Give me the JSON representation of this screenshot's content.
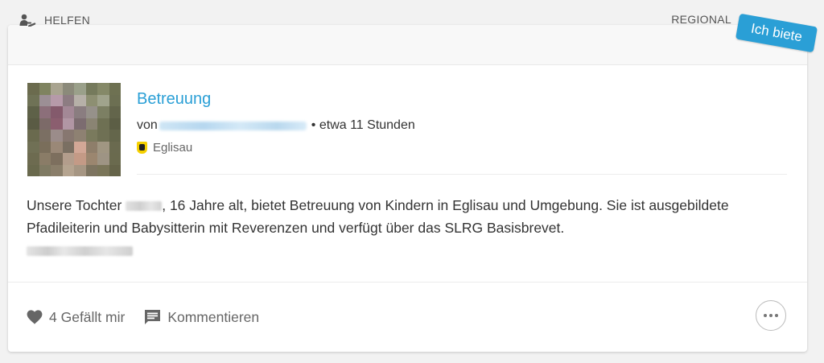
{
  "header": {
    "category": "HELFEN",
    "region": "REGIONAL",
    "badge": "Ich biete"
  },
  "post": {
    "title": "Betreuung",
    "by_prefix": "von",
    "time": "• etwa 11 Stunden",
    "location": "Eglisau",
    "text_part1": "Unsere Tochter ",
    "text_part2": ", 16 Jahre alt, bietet Betreuung von Kindern in Eglisau und Umgebung. Sie ist ausgebildete Pfadileiterin und Babysitterin mit Reverenzen und verfügt über das SLRG Basisbrevet."
  },
  "actions": {
    "like": "4 Gefällt mir",
    "comment": "Kommentieren"
  },
  "colors": {
    "accent": "#2a9fd6",
    "background": "#f2f2f2"
  },
  "icons": {
    "category": "helping-hand-icon",
    "like": "heart-icon",
    "comment": "comment-icon",
    "more": "more-icon"
  }
}
